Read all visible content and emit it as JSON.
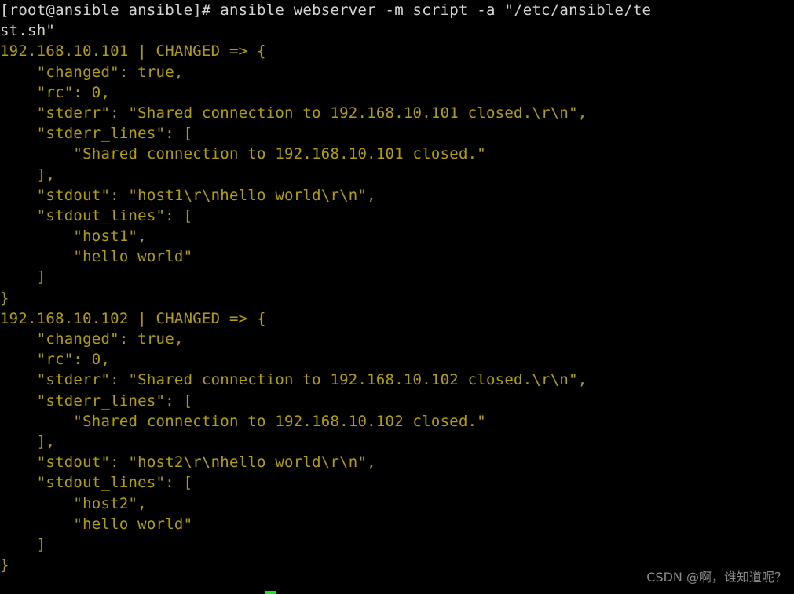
{
  "terminal": {
    "background_color": "#000000",
    "prompt_color": "#d6d6d6",
    "output_color": "#b3a000",
    "cursor_color": "#2bd82b",
    "columns": 74,
    "lines": [
      {
        "text": "[root@ansible ansible]# ansible webserver -m script -a \"/etc/ansible/te",
        "color": "prompt"
      },
      {
        "text": "st.sh\"",
        "color": "prompt"
      },
      {
        "text": "192.168.10.101 | CHANGED => {",
        "color": "output"
      },
      {
        "text": "    \"changed\": true,",
        "color": "output"
      },
      {
        "text": "    \"rc\": 0,",
        "color": "output"
      },
      {
        "text": "    \"stderr\": \"Shared connection to 192.168.10.101 closed.\\r\\n\",",
        "color": "output"
      },
      {
        "text": "    \"stderr_lines\": [",
        "color": "output"
      },
      {
        "text": "        \"Shared connection to 192.168.10.101 closed.\"",
        "color": "output"
      },
      {
        "text": "    ],",
        "color": "output"
      },
      {
        "text": "    \"stdout\": \"host1\\r\\nhello world\\r\\n\",",
        "color": "output"
      },
      {
        "text": "    \"stdout_lines\": [",
        "color": "output"
      },
      {
        "text": "        \"host1\",",
        "color": "output"
      },
      {
        "text": "        \"hello world\"",
        "color": "output"
      },
      {
        "text": "    ]",
        "color": "output"
      },
      {
        "text": "}",
        "color": "output"
      },
      {
        "text": "192.168.10.102 | CHANGED => {",
        "color": "output"
      },
      {
        "text": "    \"changed\": true,",
        "color": "output"
      },
      {
        "text": "    \"rc\": 0,",
        "color": "output"
      },
      {
        "text": "    \"stderr\": \"Shared connection to 192.168.10.102 closed.\\r\\n\",",
        "color": "output"
      },
      {
        "text": "    \"stderr_lines\": [",
        "color": "output"
      },
      {
        "text": "        \"Shared connection to 192.168.10.102 closed.\"",
        "color": "output"
      },
      {
        "text": "    ],",
        "color": "output"
      },
      {
        "text": "    \"stdout\": \"host2\\r\\nhello world\\r\\n\",",
        "color": "output"
      },
      {
        "text": "    \"stdout_lines\": [",
        "color": "output"
      },
      {
        "text": "        \"host2\",",
        "color": "output"
      },
      {
        "text": "        \"hello world\"",
        "color": "output"
      },
      {
        "text": "    ]",
        "color": "output"
      },
      {
        "text": "}",
        "color": "output"
      }
    ]
  },
  "command": {
    "prompt": "[root@ansible ansible]#",
    "user": "root",
    "host": "ansible",
    "cwd": "ansible",
    "executable": "ansible",
    "target_group": "webserver",
    "module_flag": "-m",
    "module": "script",
    "args_flag": "-a",
    "args_value": "/etc/ansible/test.sh",
    "full": "ansible webserver -m script -a \"/etc/ansible/test.sh\""
  },
  "results": [
    {
      "host": "192.168.10.101",
      "status": "CHANGED",
      "changed": "true",
      "rc": "0",
      "stderr": "Shared connection to 192.168.10.101 closed.\\r\\n",
      "stderr_lines": [
        "Shared connection to 192.168.10.101 closed."
      ],
      "stdout": "host1\\r\\nhello world\\r\\n",
      "stdout_lines": [
        "host1",
        "hello world"
      ]
    },
    {
      "host": "192.168.10.102",
      "status": "CHANGED",
      "changed": "true",
      "rc": "0",
      "stderr": "Shared connection to 192.168.10.102 closed.\\r\\n",
      "stderr_lines": [
        "Shared connection to 192.168.10.102 closed."
      ],
      "stdout": "host2\\r\\nhello world\\r\\n",
      "stdout_lines": [
        "host2",
        "hello world"
      ]
    }
  ],
  "watermark": {
    "text": "CSDN @啊，谁知道呢？",
    "color": "#8c8c8c"
  }
}
